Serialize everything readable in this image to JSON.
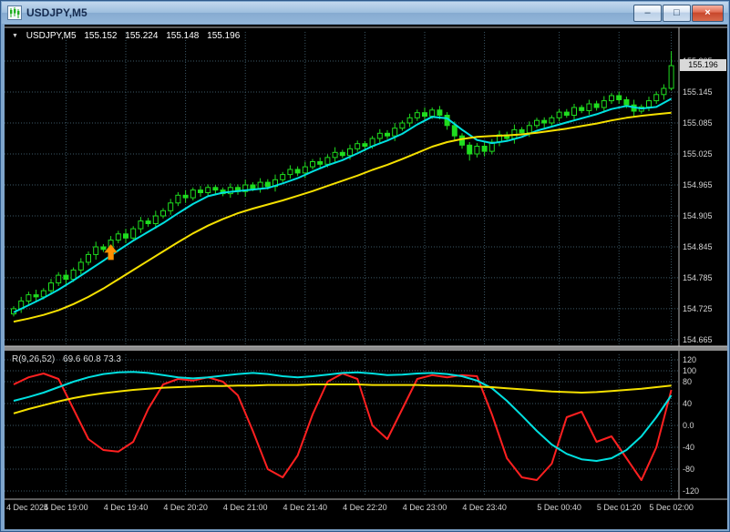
{
  "window": {
    "title": "USDJPY,M5",
    "controls": {
      "minimize": "–",
      "maximize": "□",
      "close": "×"
    }
  },
  "info_line": {
    "symbol_period": "USDJPY,M5",
    "open": "155.152",
    "high": "155.224",
    "low": "155.148",
    "close": "155.196"
  },
  "price_box": "155.196",
  "price_axis_labels": [
    "155.205",
    "155.145",
    "155.085",
    "155.025",
    "154.965",
    "154.905",
    "154.845",
    "154.785",
    "154.725",
    "154.665"
  ],
  "indicator": {
    "label": "R(9,26,52)",
    "values": "69.6 60.8 73.3",
    "axis_labels": [
      "120",
      "100",
      "80",
      "40",
      "0.0",
      "-40",
      "-80",
      "-120"
    ]
  },
  "time_axis": [
    {
      "text": "4 Dec 2025",
      "bar": 0
    },
    {
      "text": "4 Dec 19:00",
      "bar": 7
    },
    {
      "text": "4 Dec 19:40",
      "bar": 15
    },
    {
      "text": "4 Dec 20:20",
      "bar": 23
    },
    {
      "text": "4 Dec 21:00",
      "bar": 31
    },
    {
      "text": "4 Dec 21:40",
      "bar": 39
    },
    {
      "text": "4 Dec 22:20",
      "bar": 47
    },
    {
      "text": "4 Dec 23:00",
      "bar": 55
    },
    {
      "text": "4 Dec 23:40",
      "bar": 63
    },
    {
      "text": "5 Dec 00:40",
      "bar": 73
    },
    {
      "text": "5 Dec 01:20",
      "bar": 81
    },
    {
      "text": "5 Dec 02:00",
      "bar": 88
    }
  ],
  "signal_arrow": {
    "bar": 13,
    "price": 154.834,
    "color": "#ff9100"
  },
  "colors": {
    "chart_bg": "#000000",
    "grid": "#3c5866",
    "candle": "#1fdd1f",
    "bull_fill": "#000000",
    "bear_fill": "#1fdd1f",
    "frame": "#b8b8b8",
    "splitter": "#8c8c8c",
    "price_marker_bg": "#d9d9d9",
    "arrow": "#ff9100"
  },
  "chart_data": {
    "type": "candlestick",
    "symbol": "USDJPY",
    "timeframe": "M5",
    "price_gridline_step": 0.06,
    "candles": [
      [
        154.715,
        154.73,
        154.71,
        154.725
      ],
      [
        154.725,
        154.748,
        154.717,
        154.74
      ],
      [
        154.74,
        154.758,
        154.734,
        154.752
      ],
      [
        154.752,
        154.762,
        154.738,
        154.748
      ],
      [
        154.748,
        154.765,
        154.743,
        154.76
      ],
      [
        154.76,
        154.783,
        154.752,
        154.775
      ],
      [
        154.775,
        154.796,
        154.769,
        154.79
      ],
      [
        154.79,
        154.8,
        154.772,
        154.782
      ],
      [
        154.782,
        154.805,
        154.777,
        154.8
      ],
      [
        154.8,
        154.823,
        154.792,
        154.815
      ],
      [
        154.815,
        154.836,
        154.809,
        154.83
      ],
      [
        154.83,
        154.855,
        154.82,
        154.845
      ],
      [
        154.845,
        154.85,
        154.835,
        154.84
      ],
      [
        154.84,
        154.866,
        154.832,
        154.858
      ],
      [
        154.858,
        154.876,
        154.852,
        154.87
      ],
      [
        154.87,
        154.88,
        154.852,
        154.862
      ],
      [
        154.862,
        154.885,
        154.857,
        154.88
      ],
      [
        154.88,
        154.903,
        154.872,
        154.895
      ],
      [
        154.895,
        154.901,
        154.884,
        154.89
      ],
      [
        154.89,
        154.915,
        154.88,
        154.905
      ],
      [
        154.905,
        154.92,
        154.9,
        154.915
      ],
      [
        154.915,
        154.938,
        154.907,
        154.93
      ],
      [
        154.93,
        154.951,
        154.924,
        154.945
      ],
      [
        154.945,
        154.955,
        154.93,
        154.94
      ],
      [
        154.94,
        154.96,
        154.935,
        154.955
      ],
      [
        154.955,
        154.963,
        154.942,
        154.95
      ],
      [
        154.95,
        154.966,
        154.944,
        154.96
      ],
      [
        154.96,
        154.965,
        154.945,
        154.955
      ],
      [
        154.955,
        154.96,
        154.943,
        154.948
      ],
      [
        154.948,
        154.968,
        154.94,
        154.96
      ],
      [
        154.96,
        154.966,
        154.946,
        154.952
      ],
      [
        154.952,
        154.975,
        154.942,
        154.965
      ],
      [
        154.965,
        154.97,
        154.953,
        154.958
      ],
      [
        154.958,
        154.978,
        154.95,
        154.97
      ],
      [
        154.97,
        154.976,
        154.956,
        154.962
      ],
      [
        154.962,
        154.985,
        154.952,
        154.975
      ],
      [
        154.975,
        154.99,
        154.97,
        154.985
      ],
      [
        154.985,
        155.003,
        154.977,
        154.995
      ],
      [
        154.995,
        155.001,
        154.982,
        154.988
      ],
      [
        154.988,
        155.01,
        154.978,
        155.0
      ],
      [
        155.0,
        155.015,
        154.995,
        155.01
      ],
      [
        155.01,
        155.018,
        154.997,
        155.005
      ],
      [
        155.005,
        155.024,
        154.999,
        155.018
      ],
      [
        155.018,
        155.038,
        155.008,
        155.028
      ],
      [
        155.028,
        155.033,
        155.017,
        155.022
      ],
      [
        155.022,
        155.043,
        155.014,
        155.035
      ],
      [
        155.035,
        155.051,
        155.029,
        155.045
      ],
      [
        155.045,
        155.05,
        155.03,
        155.04
      ],
      [
        155.04,
        155.06,
        155.035,
        155.055
      ],
      [
        155.055,
        155.073,
        155.047,
        155.065
      ],
      [
        155.065,
        155.071,
        155.054,
        155.06
      ],
      [
        155.06,
        155.085,
        155.05,
        155.075
      ],
      [
        155.075,
        155.09,
        155.07,
        155.085
      ],
      [
        155.085,
        155.103,
        155.077,
        155.095
      ],
      [
        155.095,
        155.111,
        155.089,
        155.105
      ],
      [
        155.105,
        155.115,
        155.088,
        155.098
      ],
      [
        155.098,
        155.115,
        155.093,
        155.11
      ],
      [
        155.11,
        155.118,
        155.092,
        155.1
      ],
      [
        155.1,
        155.106,
        155.072,
        155.08
      ],
      [
        155.08,
        155.088,
        155.05,
        155.06
      ],
      [
        155.06,
        155.065,
        155.035,
        155.042
      ],
      [
        155.042,
        155.048,
        155.012,
        155.025
      ],
      [
        155.025,
        155.046,
        155.018,
        155.04
      ],
      [
        155.04,
        155.048,
        155.02,
        155.03
      ],
      [
        155.03,
        155.054,
        155.024,
        155.048
      ],
      [
        155.048,
        155.07,
        155.04,
        155.062
      ],
      [
        155.062,
        155.068,
        155.049,
        155.055
      ],
      [
        155.055,
        155.082,
        155.045,
        155.072
      ],
      [
        155.072,
        155.077,
        155.061,
        155.066
      ],
      [
        155.066,
        155.088,
        155.058,
        155.08
      ],
      [
        155.08,
        155.095,
        155.075,
        155.09
      ],
      [
        155.09,
        155.096,
        155.076,
        155.085
      ],
      [
        155.085,
        155.1,
        155.08,
        155.095
      ],
      [
        155.095,
        155.112,
        155.088,
        155.106
      ],
      [
        155.106,
        155.112,
        155.095,
        155.1
      ],
      [
        155.1,
        155.122,
        155.092,
        155.115
      ],
      [
        155.115,
        155.12,
        155.104,
        155.109
      ],
      [
        155.109,
        155.13,
        155.101,
        155.122
      ],
      [
        155.122,
        155.128,
        155.109,
        155.115
      ],
      [
        155.115,
        155.137,
        155.105,
        155.128
      ],
      [
        155.128,
        155.143,
        155.122,
        155.138
      ],
      [
        155.138,
        155.146,
        155.122,
        155.13
      ],
      [
        155.13,
        155.136,
        155.114,
        155.12
      ],
      [
        155.12,
        155.13,
        155.098,
        155.108
      ],
      [
        155.108,
        155.121,
        155.103,
        155.116
      ],
      [
        155.116,
        155.136,
        155.108,
        155.128
      ],
      [
        155.128,
        155.146,
        155.122,
        155.14
      ],
      [
        155.14,
        155.16,
        155.13,
        155.152
      ],
      [
        155.152,
        155.224,
        155.148,
        155.196
      ]
    ],
    "overlays": [
      {
        "name": "ma-fast-line",
        "color": "#00e0e0",
        "step": 2,
        "values": [
          154.718,
          154.732,
          154.746,
          154.762,
          154.78,
          154.799,
          154.818,
          154.838,
          154.857,
          154.874,
          154.891,
          154.91,
          154.928,
          154.943,
          154.95,
          154.953,
          154.956,
          154.959,
          154.968,
          154.978,
          154.991,
          155.003,
          155.013,
          155.026,
          155.04,
          155.051,
          155.064,
          155.082,
          155.097,
          155.094,
          155.072,
          155.052,
          155.046,
          155.05,
          155.058,
          155.07,
          155.078,
          155.086,
          155.094,
          155.102,
          155.112,
          155.118,
          155.113,
          155.116,
          155.132
        ]
      },
      {
        "name": "ma-slow-line",
        "color": "#f5e000",
        "step": 2,
        "values": [
          154.7,
          154.706,
          154.713,
          154.722,
          154.734,
          154.748,
          154.764,
          154.782,
          154.8,
          154.818,
          154.836,
          154.854,
          154.871,
          154.886,
          154.899,
          154.91,
          154.919,
          154.927,
          154.935,
          154.944,
          154.953,
          154.963,
          154.973,
          154.983,
          154.994,
          155.004,
          155.015,
          155.027,
          155.039,
          155.048,
          155.054,
          155.058,
          155.06,
          155.061,
          155.063,
          155.066,
          155.07,
          155.074,
          155.079,
          155.084,
          155.09,
          155.095,
          155.099,
          155.102,
          155.105
        ]
      }
    ],
    "oscillator": {
      "name": "R(9,26,52)",
      "current_values": [
        69.6,
        60.8,
        73.3
      ],
      "range": [
        -130,
        130
      ],
      "series": [
        {
          "name": "osc-fast-line",
          "color": "#ff2020",
          "step": 2,
          "values": [
            75,
            88,
            95,
            85,
            30,
            -25,
            -45,
            -48,
            -30,
            30,
            75,
            85,
            82,
            88,
            80,
            55,
            -10,
            -80,
            -95,
            -55,
            20,
            80,
            95,
            85,
            0,
            -25,
            30,
            85,
            92,
            88,
            92,
            90,
            20,
            -60,
            -95,
            -100,
            -70,
            15,
            25,
            -30,
            -20,
            -60,
            -100,
            -40,
            65
          ]
        },
        {
          "name": "osc-mid-line",
          "color": "#00e0e0",
          "step": 2,
          "values": [
            45,
            52,
            60,
            70,
            80,
            88,
            94,
            97,
            98,
            96,
            92,
            88,
            86,
            88,
            91,
            94,
            96,
            94,
            90,
            88,
            90,
            93,
            96,
            97,
            95,
            92,
            93,
            95,
            96,
            94,
            90,
            82,
            68,
            45,
            18,
            -10,
            -35,
            -52,
            -62,
            -65,
            -60,
            -45,
            -20,
            15,
            55
          ]
        },
        {
          "name": "osc-slow-line",
          "color": "#f5e000",
          "step": 2,
          "values": [
            22,
            30,
            37,
            44,
            50,
            55,
            59,
            62,
            65,
            67,
            69,
            70,
            71,
            72,
            72,
            73,
            73,
            74,
            74,
            74,
            75,
            75,
            75,
            75,
            74,
            74,
            74,
            74,
            73,
            73,
            72,
            71,
            70,
            68,
            66,
            64,
            62,
            61,
            60,
            61,
            63,
            65,
            67,
            70,
            73
          ]
        }
      ]
    }
  }
}
